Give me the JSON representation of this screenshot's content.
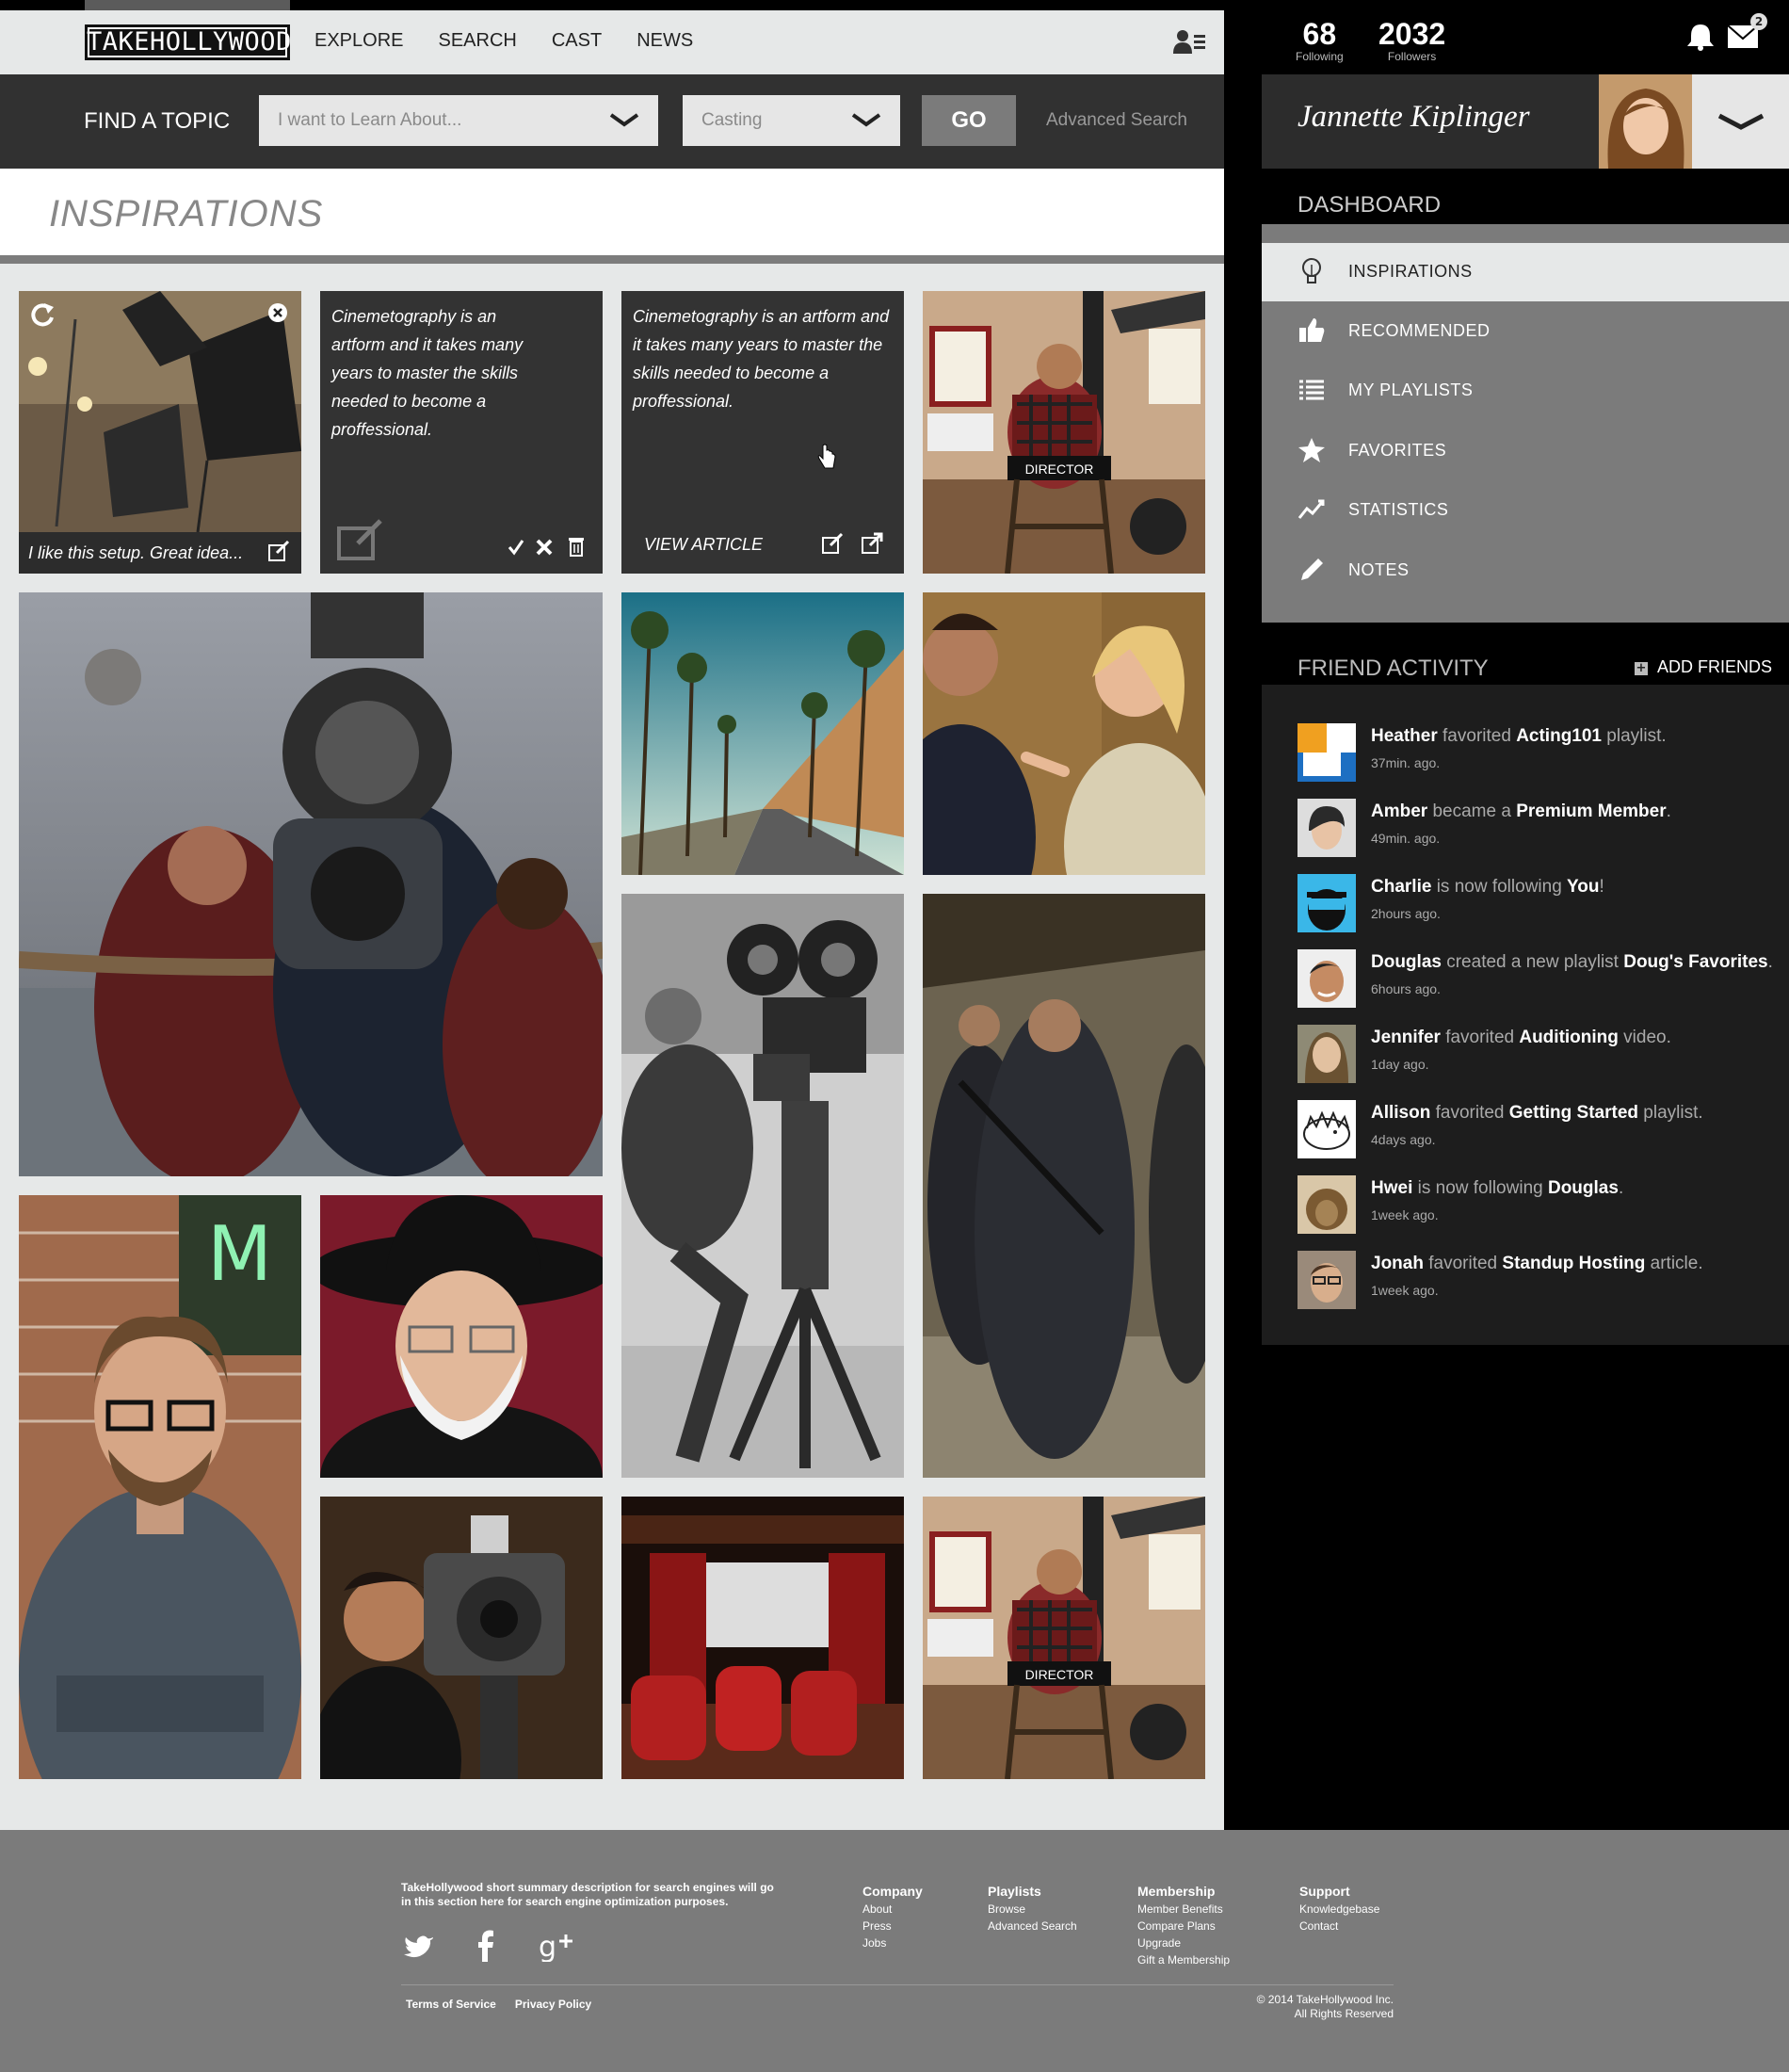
{
  "nav": {
    "logo": "TAKEHOLLYWOOD",
    "links": [
      "EXPLORE",
      "SEARCH",
      "CAST",
      "NEWS"
    ]
  },
  "search": {
    "label": "FIND A TOPIC",
    "topic_placeholder": "I want to Learn About...",
    "category_value": "Casting",
    "go_label": "GO",
    "advanced_label": "Advanced Search"
  },
  "page": {
    "title": "INSPIRATIONS"
  },
  "tiles": {
    "setup_caption": "I like this setup. Great idea...",
    "note_text": "Cinemetography is an artform and it takes many years to master the skills needed to become a proffessional.",
    "article_text": "Cinemetography is an artform and it takes many years to master the skills needed to become a proffessional.",
    "view_article": "VIEW ARTICLE",
    "director_label": "DIRECTOR"
  },
  "header": {
    "following_count": "68",
    "following_label": "Following",
    "followers_count": "2032",
    "followers_label": "Followers",
    "mail_badge": "2"
  },
  "profile": {
    "name": "Jannette Kiplinger"
  },
  "dashboard": {
    "title": "DASHBOARD",
    "items": [
      {
        "label": "INSPIRATIONS",
        "icon": "lightbulb-icon",
        "active": true
      },
      {
        "label": "RECOMMENDED",
        "icon": "thumbs-up-icon"
      },
      {
        "label": "MY PLAYLISTS",
        "icon": "list-icon"
      },
      {
        "label": "FAVORITES",
        "icon": "star-icon"
      },
      {
        "label": "STATISTICS",
        "icon": "chart-line-icon"
      },
      {
        "label": "NOTES",
        "icon": "pencil-icon"
      }
    ]
  },
  "friends": {
    "title": "FRIEND ACTIVITY",
    "add_label": "ADD FRIENDS",
    "items": [
      {
        "name": "Heather",
        "action": " favorited ",
        "object": "Acting101",
        "tail": " playlist.",
        "time": "37min. ago."
      },
      {
        "name": "Amber",
        "action": " became a ",
        "object": "Premium Member",
        "tail": ".",
        "time": "49min. ago."
      },
      {
        "name": "Charlie",
        "action": " is now following ",
        "object": "You",
        "tail": "!",
        "time": "2hours ago."
      },
      {
        "name": "Douglas",
        "action": " created a new playlist ",
        "object": "Doug's Favorites",
        "tail": ". ",
        "time": "6hours ago."
      },
      {
        "name": "Jennifer",
        "action": " favorited ",
        "object": "Auditioning",
        "tail": " video.",
        "time": "1day ago."
      },
      {
        "name": "Allison",
        "action": " favorited ",
        "object": "Getting Started",
        "tail": " playlist.",
        "time": "4days ago."
      },
      {
        "name": "Hwei",
        "action": " is now following ",
        "object": "Douglas",
        "tail": ".",
        "time": "1week ago."
      },
      {
        "name": "Jonah",
        "action": " favorited ",
        "object": "Standup Hosting",
        "tail": " article.",
        "time": "1week ago."
      }
    ]
  },
  "footer": {
    "description": "TakeHollywood short summary description for  search engines will go in this section here for search engine optimization purposes.",
    "columns": [
      {
        "title": "Company",
        "links": [
          "About",
          "Press",
          "Jobs"
        ]
      },
      {
        "title": "Playlists",
        "links": [
          "Browse",
          "Advanced Search"
        ]
      },
      {
        "title": "Membership",
        "links": [
          "Member Benefits",
          "Compare Plans",
          "Upgrade",
          "Gift a Membership"
        ]
      },
      {
        "title": "Support",
        "links": [
          "Knowledgebase",
          "Contact"
        ]
      }
    ],
    "terms": "Terms of Service",
    "privacy": "Privacy Policy",
    "copyright_1": "© 2014 TakeHollywood Inc.",
    "copyright_2": "All Rights Reserved"
  }
}
